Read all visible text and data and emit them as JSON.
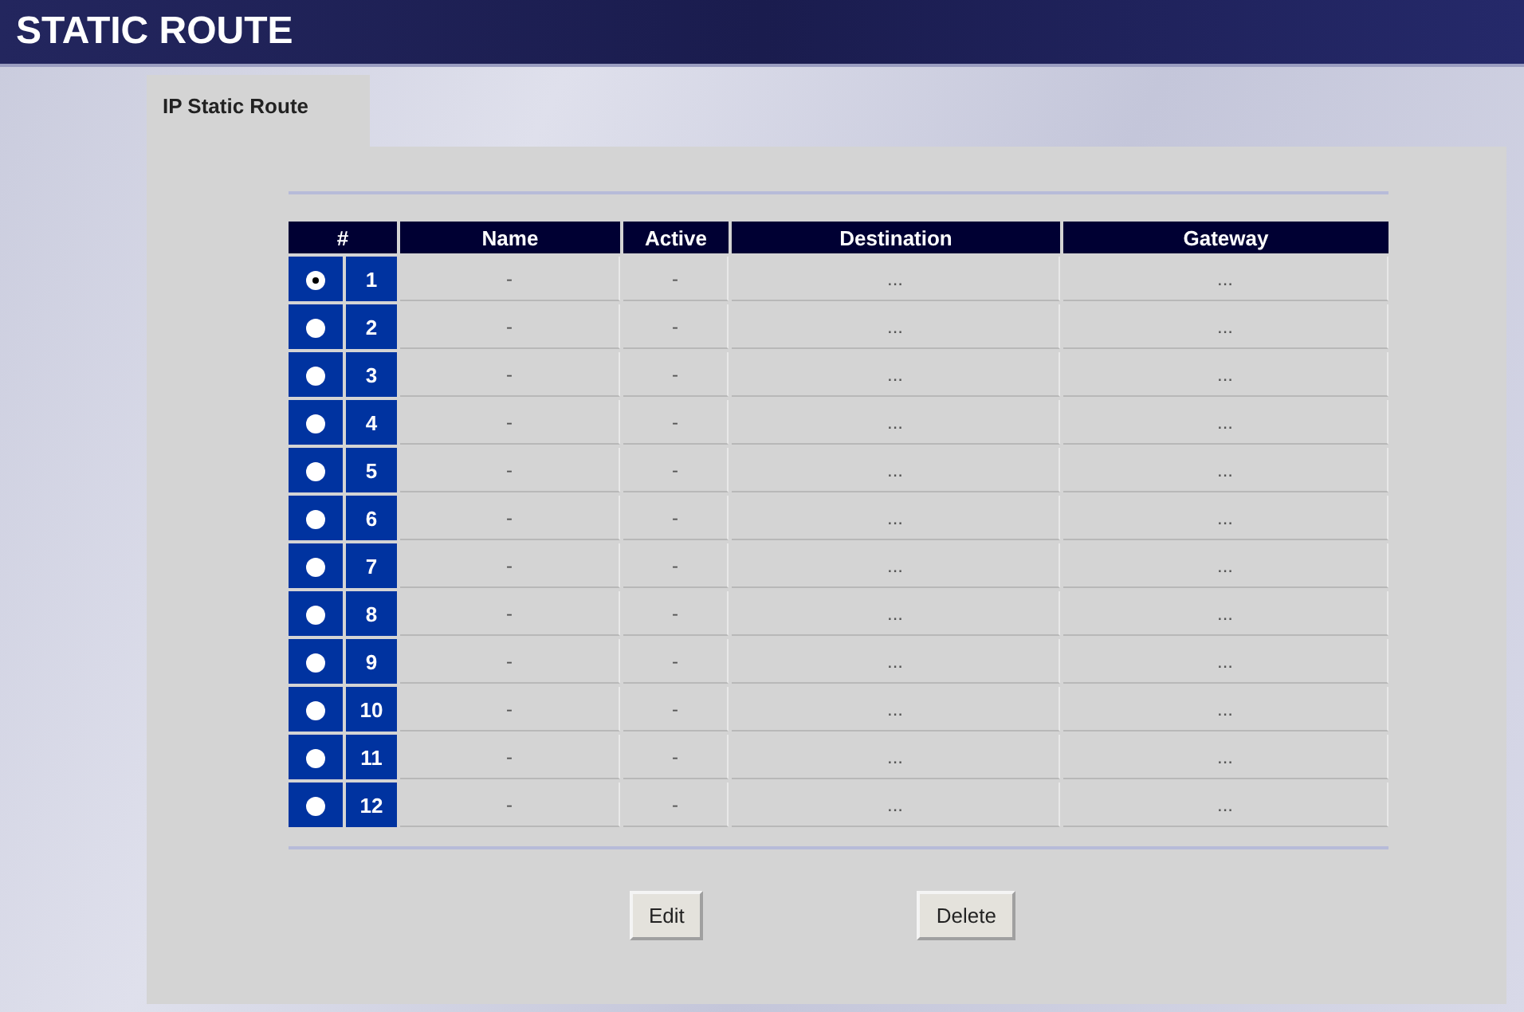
{
  "header": {
    "title": "STATIC ROUTE"
  },
  "tab": {
    "label": "IP Static Route"
  },
  "table": {
    "columns": [
      "#",
      "Name",
      "Active",
      "Destination",
      "Gateway"
    ],
    "rows": [
      {
        "selected": true,
        "number": "1",
        "name": "-",
        "active": "-",
        "destination": "...",
        "gateway": "..."
      },
      {
        "selected": false,
        "number": "2",
        "name": "-",
        "active": "-",
        "destination": "...",
        "gateway": "..."
      },
      {
        "selected": false,
        "number": "3",
        "name": "-",
        "active": "-",
        "destination": "...",
        "gateway": "..."
      },
      {
        "selected": false,
        "number": "4",
        "name": "-",
        "active": "-",
        "destination": "...",
        "gateway": "..."
      },
      {
        "selected": false,
        "number": "5",
        "name": "-",
        "active": "-",
        "destination": "...",
        "gateway": "..."
      },
      {
        "selected": false,
        "number": "6",
        "name": "-",
        "active": "-",
        "destination": "...",
        "gateway": "..."
      },
      {
        "selected": false,
        "number": "7",
        "name": "-",
        "active": "-",
        "destination": "...",
        "gateway": "..."
      },
      {
        "selected": false,
        "number": "8",
        "name": "-",
        "active": "-",
        "destination": "...",
        "gateway": "..."
      },
      {
        "selected": false,
        "number": "9",
        "name": "-",
        "active": "-",
        "destination": "...",
        "gateway": "..."
      },
      {
        "selected": false,
        "number": "10",
        "name": "-",
        "active": "-",
        "destination": "...",
        "gateway": "..."
      },
      {
        "selected": false,
        "number": "11",
        "name": "-",
        "active": "-",
        "destination": "...",
        "gateway": "..."
      },
      {
        "selected": false,
        "number": "12",
        "name": "-",
        "active": "-",
        "destination": "...",
        "gateway": "..."
      }
    ]
  },
  "buttons": [
    "Edit",
    "Delete"
  ]
}
